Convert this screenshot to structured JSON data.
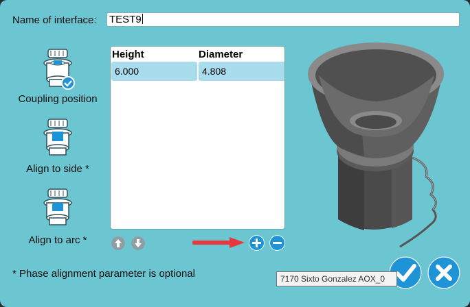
{
  "name_field": {
    "label": "Name of interface:",
    "value": "TEST9"
  },
  "modes": [
    {
      "label": "Coupling position",
      "icon": "coupling-position-icon",
      "selected": true
    },
    {
      "label": "Align to side *",
      "icon": "align-to-side-icon",
      "selected": false
    },
    {
      "label": "Align to arc *",
      "icon": "align-to-arc-icon",
      "selected": false
    }
  ],
  "table": {
    "headers": [
      "Height",
      "Diameter"
    ],
    "rows": [
      {
        "height": "6.000",
        "diameter": "4.808"
      }
    ]
  },
  "row_controls": {
    "move_up": "arrow-up-icon",
    "move_down": "arrow-down-icon",
    "add": "plus-icon",
    "remove": "minus-icon"
  },
  "note": "* Phase alignment parameter is optional",
  "tooltip": "7170 Sixto Gonzalez AOX_0",
  "actions": {
    "confirm": "checkmark-icon",
    "cancel": "close-icon"
  },
  "colors": {
    "dialog_bg": "#6cc6d2",
    "accent_blue": "#1e93d6",
    "row_highlight": "#a9dcec",
    "annotation_arrow": "#e8383d"
  }
}
